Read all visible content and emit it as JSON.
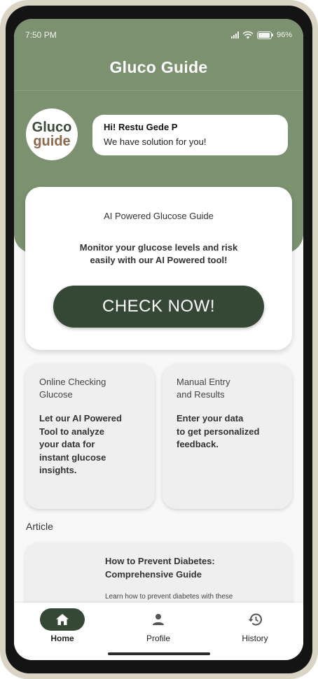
{
  "status_bar": {
    "time": "7:50 PM",
    "battery": "96%",
    "battery_level": 0.96
  },
  "app": {
    "title": "Gluco Guide"
  },
  "logo": {
    "line1": "Gluco",
    "line2": "guide"
  },
  "greeting": {
    "hello": "Hi! Restu Gede P",
    "message": "We have solution for you!"
  },
  "hero": {
    "subtitle": "AI Powered Glucose Guide",
    "description": "Monitor your glucose levels and risk easily with our AI Powered tool!",
    "button": "CHECK NOW!"
  },
  "features": [
    {
      "title": "Online Checking\nGlucose",
      "description": "Let our AI Powered\nTool to analyze\nyour data for\ninstant glucose\ninsights."
    },
    {
      "title": "Manual Entry\nand Results",
      "description": "Enter your data\nto get personalized\nfeedback."
    }
  ],
  "article": {
    "section_label": "Article",
    "title": "How to Prevent Diabetes: Comprehensive Guide",
    "snippet": "Learn how to prevent diabetes with these"
  },
  "nav": [
    {
      "label": "Home",
      "icon": "home-icon",
      "active": true
    },
    {
      "label": "Profile",
      "icon": "person-icon",
      "active": false
    },
    {
      "label": "History",
      "icon": "history-icon",
      "active": false
    }
  ],
  "colors": {
    "header": "#7b916f",
    "primary_dark": "#354836",
    "card": "#efefef"
  }
}
